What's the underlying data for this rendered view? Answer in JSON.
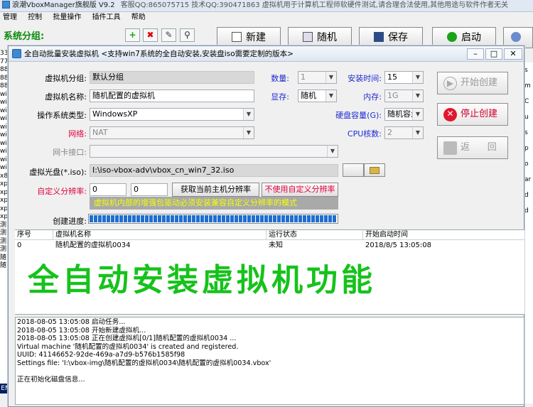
{
  "app": {
    "title": "浪潮VboxManager旗舰版 V9.2",
    "notice": "客服QQ:865075715 技术QQ:390471863    虚拟机用于计算机工程师软硬件测试,请合理合法使用,其他用途与软件作者无关",
    "menu": [
      "管理",
      "控制",
      "批量操作",
      "插件工具",
      "帮助"
    ],
    "group_label": "系统分组:",
    "toolbar": {
      "new_label": "新建",
      "random_label": "随机",
      "save_label": "保存",
      "start_label": "启动"
    },
    "left_list": [
      "33",
      "77",
      "88",
      "88",
      "88",
      "wi",
      "wi",
      "wi",
      "wi",
      "wi",
      "wi",
      "wi",
      "wi",
      "wi",
      "wi",
      "x8",
      "xp",
      "xp",
      "xp",
      "xp",
      "xp",
      "测",
      "测",
      "测",
      "测",
      "随",
      "随"
    ],
    "right_list": [
      "s",
      "m",
      "C",
      "u",
      "s",
      "p",
      "o",
      "ar",
      "d",
      "d"
    ],
    "status_text": "EM"
  },
  "dialog": {
    "title": "全自动批量安装虚拟机 <支持win7系统的全自动安装,安装盘iso需要定制的版本>",
    "vm_group": {
      "label": "虚拟机分组:",
      "value": "默认分组"
    },
    "vm_name": {
      "label": "虚拟机名称:",
      "value": "随机配置的虚拟机"
    },
    "os_type": {
      "label": "操作系统类型:",
      "value": "WindowsXP"
    },
    "network": {
      "label": "网络:",
      "value": "NAT"
    },
    "nic": {
      "label": "网卡接口:",
      "value": ""
    },
    "iso": {
      "label": "虚拟光盘(*.iso):",
      "value": "I:\\iso-vbox-adv\\vbox_cn_win7_32.iso"
    },
    "resolution": {
      "label": "自定义分辨率:",
      "width": "0",
      "height": "0",
      "get_label": "获取当前主机分辨率",
      "nocustom_label": "不使用自定义分辨率"
    },
    "hint": "虚拟机内部的增强包驱动必须安装兼容自定义分辨率的模式",
    "progress_label": "创建进度:",
    "progress": 1.0,
    "count": {
      "label": "数量:",
      "value": "1"
    },
    "install_time": {
      "label": "安装时间:",
      "value": "15"
    },
    "vram": {
      "label": "显存:",
      "value": "随机"
    },
    "memory": {
      "label": "内存:",
      "value": "1G"
    },
    "disk": {
      "label": "硬盘容量(G):",
      "value": "随机容量"
    },
    "cpu": {
      "label": "CPU核数:",
      "value": "2"
    },
    "start_create_label": "开始创建",
    "stop_create_label": "停止创建",
    "back_label": "返      回",
    "table": {
      "headers": [
        "序号",
        "虚拟机名称",
        "运行状态",
        "开始启动时间"
      ],
      "rows": [
        [
          "0",
          "随机配置的虚拟机0034",
          "未知",
          "2018/8/5 13:05:08"
        ]
      ]
    },
    "overlay_text": "全自动安装虚拟机功能",
    "log": [
      "2018-08-05 13:05:08 启动任务...",
      "2018-08-05 13:05:08 开始新建虚拟机...",
      "2018-08-05 13:05:08 正在创建虚拟机[0/1]随机配置的虚拟机0034 ...",
      "Virtual machine '随机配置的虚拟机0034' is created and registered.",
      "UUID: 41146652-92de-469a-a7d9-b576b1585f98",
      "Settings file: 'I:\\vbox-img\\随机配置的虚拟机0034\\随机配置的虚拟机0034.vbox'",
      "",
      " 正在初始化磁盘信息..."
    ]
  }
}
